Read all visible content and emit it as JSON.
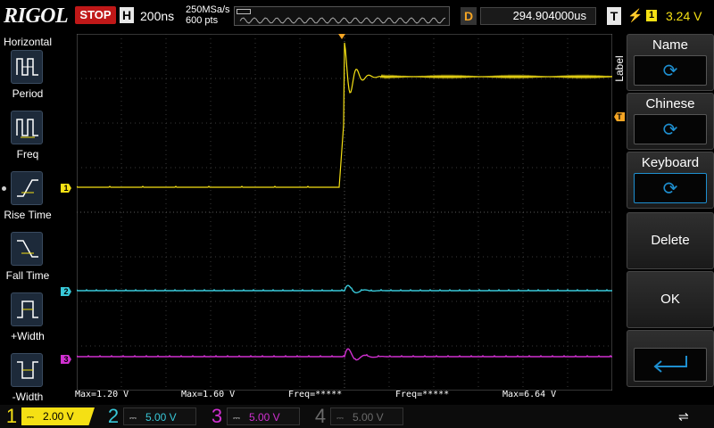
{
  "brand": "RIGOL",
  "run_status": "STOP",
  "horizontal": {
    "badge": "H",
    "timebase": "200ns",
    "sample_rate": "250MSa/s",
    "points": "600 pts"
  },
  "delay": {
    "badge": "D",
    "value": "294.904000us"
  },
  "trigger": {
    "badge": "T",
    "edge_icon": "rising-edge-icon",
    "channel": "1",
    "level": "3.24 V"
  },
  "left_panel": {
    "title": "Horizontal",
    "items": [
      {
        "label": "Period",
        "icon": "period-icon"
      },
      {
        "label": "Freq",
        "icon": "freq-icon"
      },
      {
        "label": "Rise Time",
        "icon": "rise-time-icon"
      },
      {
        "label": "Fall Time",
        "icon": "fall-time-icon"
      },
      {
        "label": "+Width",
        "icon": "positive-width-icon"
      },
      {
        "label": "-Width",
        "icon": "negative-width-icon"
      }
    ]
  },
  "right_menu": {
    "tab_label": "Label",
    "items": [
      {
        "label": "Name",
        "type": "knob"
      },
      {
        "label": "Chinese",
        "type": "knob"
      },
      {
        "label": "Keyboard",
        "type": "knob",
        "active": true
      },
      {
        "label": "Delete",
        "type": "button"
      },
      {
        "label": "OK",
        "type": "button"
      },
      {
        "label": "",
        "type": "enter"
      }
    ]
  },
  "channel_markers": {
    "ch1": "1",
    "ch2": "2",
    "ch3": "3",
    "trigger_level": "T"
  },
  "measurements": [
    {
      "text": "Max=1.20 V",
      "color": "#38c8d8"
    },
    {
      "text": "Max=1.60 V",
      "color": "#d030d0"
    },
    {
      "text": "Freq=*****",
      "color": "#f5e014"
    },
    {
      "text": "Freq=*****",
      "color": "#38c8d8"
    },
    {
      "text": "Max=6.64 V",
      "color": "#f5e014"
    }
  ],
  "channels": [
    {
      "number": "1",
      "scale": "2.00 V",
      "color": "#f5e014",
      "enabled": true
    },
    {
      "number": "2",
      "scale": "5.00 V",
      "color": "#38c8d8",
      "enabled": true
    },
    {
      "number": "3",
      "scale": "5.00 V",
      "color": "#d030d0",
      "enabled": true
    },
    {
      "number": "4",
      "scale": "5.00 V",
      "color": "#6a6a6a",
      "enabled": false
    }
  ],
  "colors": {
    "ch1": "#f5e014",
    "ch2": "#38c8d8",
    "ch3": "#d030d0",
    "trigger": "#f5a524",
    "stop": "#c01818",
    "accent": "#1e8fd0"
  }
}
